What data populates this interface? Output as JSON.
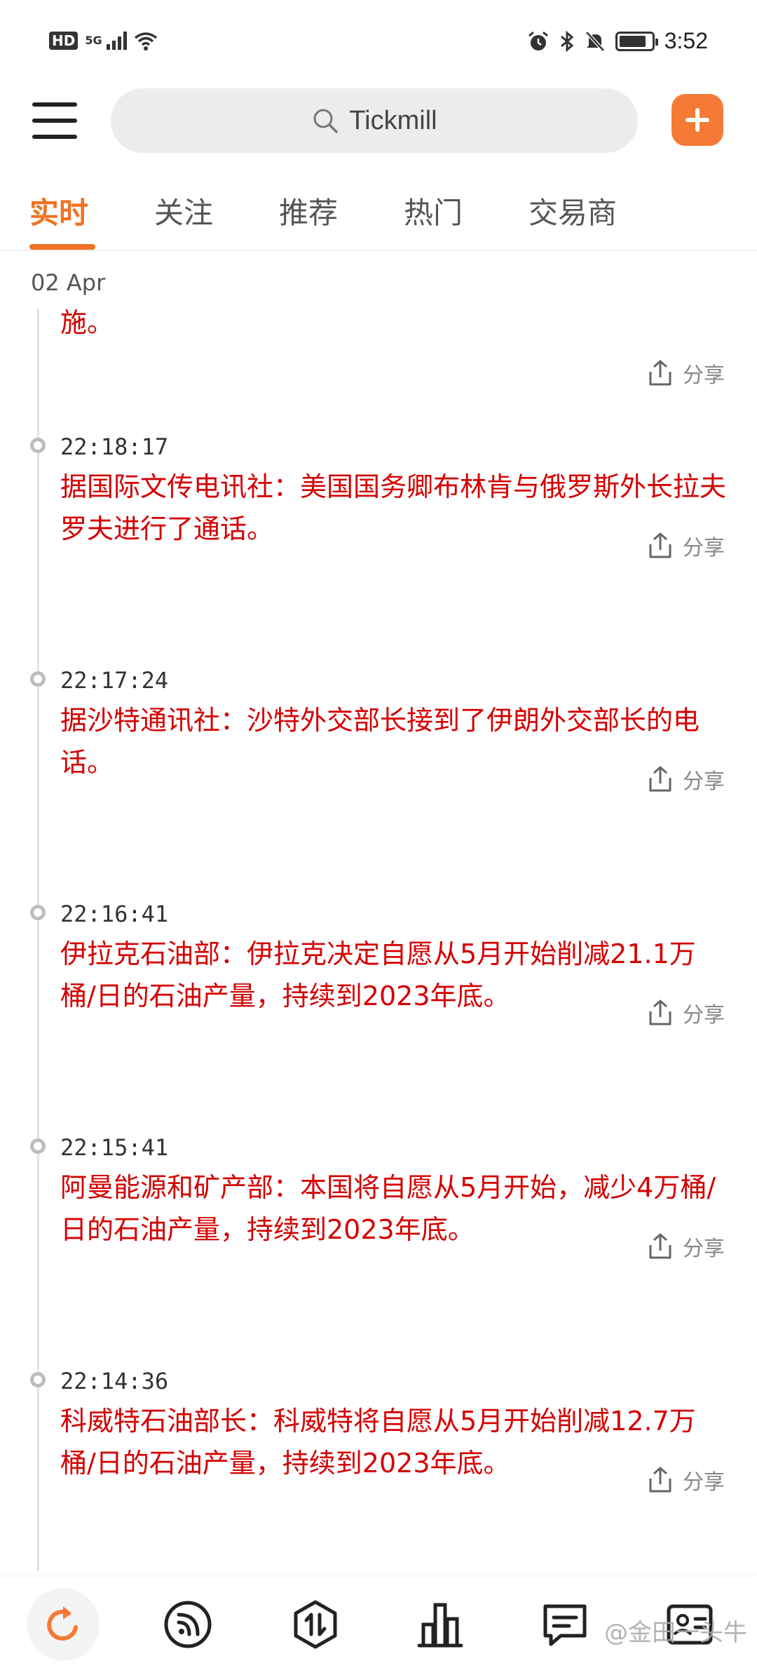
{
  "status_bar": {
    "hd": "HD",
    "network": "5G",
    "time": "3:52",
    "battery_level": 0.85
  },
  "header": {
    "search_text": "Tickmill"
  },
  "tabs": [
    {
      "label": "实时",
      "active": true
    },
    {
      "label": "关注",
      "active": false
    },
    {
      "label": "推荐",
      "active": false
    },
    {
      "label": "热门",
      "active": false
    },
    {
      "label": "交易商",
      "active": false
    }
  ],
  "feed": {
    "date": "02 Apr",
    "share_label": "分享",
    "first_fragment": "施。",
    "items": [
      {
        "time": "22:18:17",
        "text": "据国际文传电讯社：美国国务卿布林肯与俄罗斯外长拉夫罗夫进行了通话。"
      },
      {
        "time": "22:17:24",
        "text": "据沙特通讯社：沙特外交部长接到了伊朗外交部长的电话。"
      },
      {
        "time": "22:16:41",
        "text": "伊拉克石油部：伊拉克决定自愿从5月开始削减21.1万桶/日的石油产量，持续到2023年底。"
      },
      {
        "time": "22:15:41",
        "text": "阿曼能源和矿产部：本国将自愿从5月开始，减少4万桶/日的石油产量，持续到2023年底。"
      },
      {
        "time": "22:14:36",
        "text": "科威特石油部长：科威特将自愿从5月开始削减12.7万桶/日的石油产量，持续到2023年底。"
      }
    ]
  },
  "watermark": "@金田一头牛",
  "colors": {
    "accent": "#f07222",
    "news_red": "#d40000"
  }
}
